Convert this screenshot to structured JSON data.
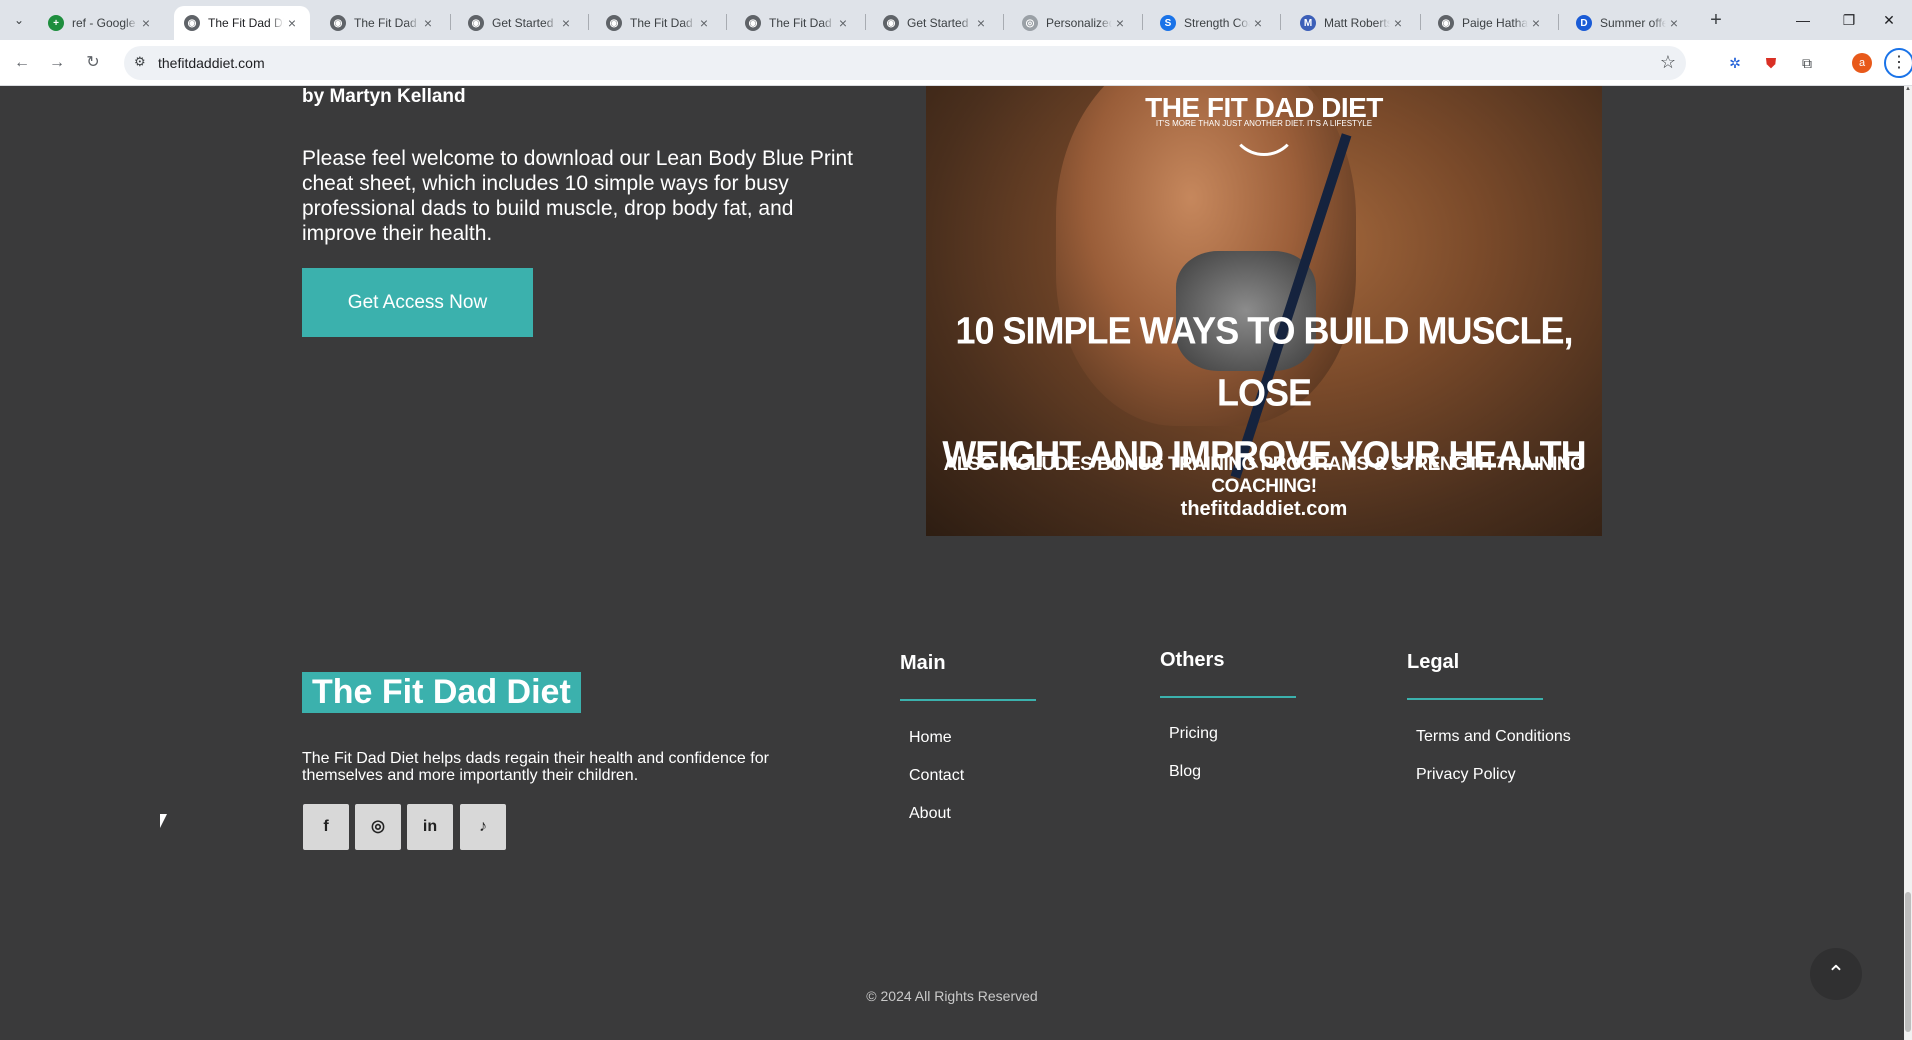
{
  "browser": {
    "tabs": [
      {
        "title": "ref - Google",
        "favicon_color": "#1e8e3e",
        "favicon_glyph": "+"
      },
      {
        "title": "The Fit Dad Diet",
        "favicon_color": "#5f6368",
        "favicon_glyph": "◉"
      },
      {
        "title": "The Fit Dad Diet",
        "favicon_color": "#5f6368",
        "favicon_glyph": "◉"
      },
      {
        "title": "Get Started",
        "favicon_color": "#5f6368",
        "favicon_glyph": "◉"
      },
      {
        "title": "The Fit Dad Diet",
        "favicon_color": "#5f6368",
        "favicon_glyph": "◉"
      },
      {
        "title": "The Fit Dad Diet",
        "favicon_color": "#5f6368",
        "favicon_glyph": "◉"
      },
      {
        "title": "Get Started",
        "favicon_color": "#5f6368",
        "favicon_glyph": "◉"
      },
      {
        "title": "Personalized",
        "favicon_color": "#9aa0a6",
        "favicon_glyph": "◎"
      },
      {
        "title": "Strength Coach",
        "favicon_color": "#1a73e8",
        "favicon_glyph": "S"
      },
      {
        "title": "Matt Roberts",
        "favicon_color": "#3c5fb8",
        "favicon_glyph": "M"
      },
      {
        "title": "Paige Hathaway",
        "favicon_color": "#5f6368",
        "favicon_glyph": "◉"
      },
      {
        "title": "Summer offer",
        "favicon_color": "#1a5bd6",
        "favicon_glyph": "D"
      }
    ],
    "active_tab": 1,
    "url": "thefitdaddiet.com",
    "profile_initial": "a"
  },
  "content": {
    "author": "by Martyn Kelland",
    "intro": "Please feel welcome to download our Lean Body Blue Print cheat sheet, which includes 10 simple ways for busy professional dads to build muscle, drop body fat, and improve their health.",
    "cta_label": "Get Access Now",
    "hero": {
      "logo": "THE FIT DAD DIET",
      "tagline": "IT'S MORE THAN JUST ANOTHER DIET. IT'S A LIFESTYLE",
      "headline_1": "10 SIMPLE WAYS TO BUILD MUSCLE, LOSE",
      "headline_2": "WEIGHT AND IMPROVE YOUR HEALTH",
      "subline": "ALSO INCLUDES BONUS TRAINING PROGRAMS & STRENGTH TRAINING COACHING!",
      "site": "thefitdaddiet.com"
    }
  },
  "footer": {
    "brand": "The Fit Dad Diet",
    "about": "The Fit Dad Diet helps dads regain their health and confidence for themselves and more importantly their children.",
    "social": [
      {
        "name": "facebook-icon",
        "glyph": "f"
      },
      {
        "name": "instagram-icon",
        "glyph": "◎"
      },
      {
        "name": "linkedin-icon",
        "glyph": "in"
      },
      {
        "name": "tiktok-icon",
        "glyph": "♪"
      }
    ],
    "main": {
      "title": "Main",
      "links": [
        "Home",
        "Contact",
        "About"
      ]
    },
    "others": {
      "title": "Others",
      "links": [
        "Pricing",
        "Blog"
      ]
    },
    "legal": {
      "title": "Legal",
      "links": [
        "Terms and Conditions",
        "Privacy Policy"
      ]
    },
    "copyright": "© 2024 All Rights Reserved"
  },
  "colors": {
    "accent": "#3bb1ad",
    "background": "#3a3a3b"
  }
}
